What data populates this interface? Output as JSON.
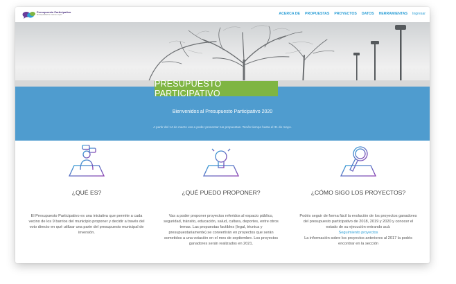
{
  "brand": {
    "title": "Presupuesto Participativo",
    "subtitle": "Municipalidad de Vicente López"
  },
  "nav": {
    "items": [
      "ACERCA DE",
      "PROPUESTAS",
      "PROYECTOS",
      "DATOS",
      "HERRAMIENTAS"
    ],
    "login": "Ingresar"
  },
  "hero": {
    "title": "PRESUPUESTO PARTICIPATIVO",
    "welcome": "Bienvenidos al Presupuesto Participativo 2020",
    "dates": "A partir del 14 de marzo vas a poder presentar tus propuestas. Tenés tiempo hasta el 31 de mayo."
  },
  "sections": [
    {
      "heading": "¿QUÉ ES?",
      "icon": "people-icon",
      "body": "El Presupuesto Participativo es una iniciativa que permite a cada vecino de los 9 barrios del municipio proponer y decidir a través del voto directo en qué utilizar una parte del presupuesto municipal de inversión."
    },
    {
      "heading": "¿QUÉ PUEDO PROPONER?",
      "icon": "lightbulb-icon",
      "body": "Vas a poder proponer proyectos referidos al espacio público, seguridad, tránsito, educación, salud, cultura, deportes, entre otros temas. Las propuestas factibles (legal, técnica y presupuestariamente) se convertirán en proyectos que serán sometidos a una votación en el mes de septiembre. Los proyectos ganadores serán realizados en 2021."
    },
    {
      "heading": "¿CÓMO SIGO LOS PROYECTOS?",
      "icon": "magnifier-icon",
      "body": "Podés seguir de forma fácil la evolución de los proyectos ganadores del presupuesto participativo de 2018, 2019 y 2020 y conocer el estado de su ejecución entrando acá:",
      "link": "Seguimiento proyectos",
      "body2": "La información sobre los proyectos anteriores al 2017 la podés encontrar en la sección"
    }
  ],
  "colors": {
    "accent_green": "#7fb543",
    "band_blue": "#4f9ccf",
    "link_blue": "#2d9fd6",
    "brand_purple": "#4a2f7e"
  }
}
